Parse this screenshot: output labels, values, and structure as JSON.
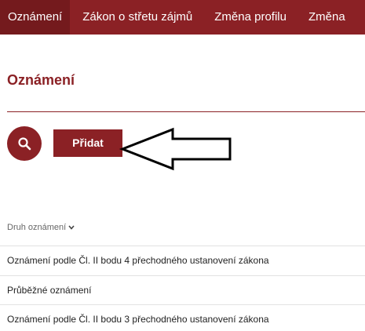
{
  "nav": {
    "items": [
      {
        "label": "Oznámení",
        "active": true
      },
      {
        "label": "Zákon o střetu zájmů",
        "active": false
      },
      {
        "label": "Změna profilu",
        "active": false
      },
      {
        "label": "Změna",
        "active": false
      }
    ]
  },
  "page": {
    "title": "Oznámení"
  },
  "toolbar": {
    "search_icon": "search-icon",
    "add_label": "Přidat"
  },
  "table": {
    "column_header": "Druh oznámení",
    "sort_icon": "chevron-down-icon",
    "rows": [
      {
        "label": "Oznámení podle Čl. II bodu 4 přechodného ustanovení zákona"
      },
      {
        "label": "Průběžné oznámení"
      },
      {
        "label": "Oznámení podle Čl. II bodu 3 přechodného ustanovení zákona"
      }
    ]
  },
  "colors": {
    "accent": "#8b2125",
    "accent_dark": "#741a1d"
  }
}
